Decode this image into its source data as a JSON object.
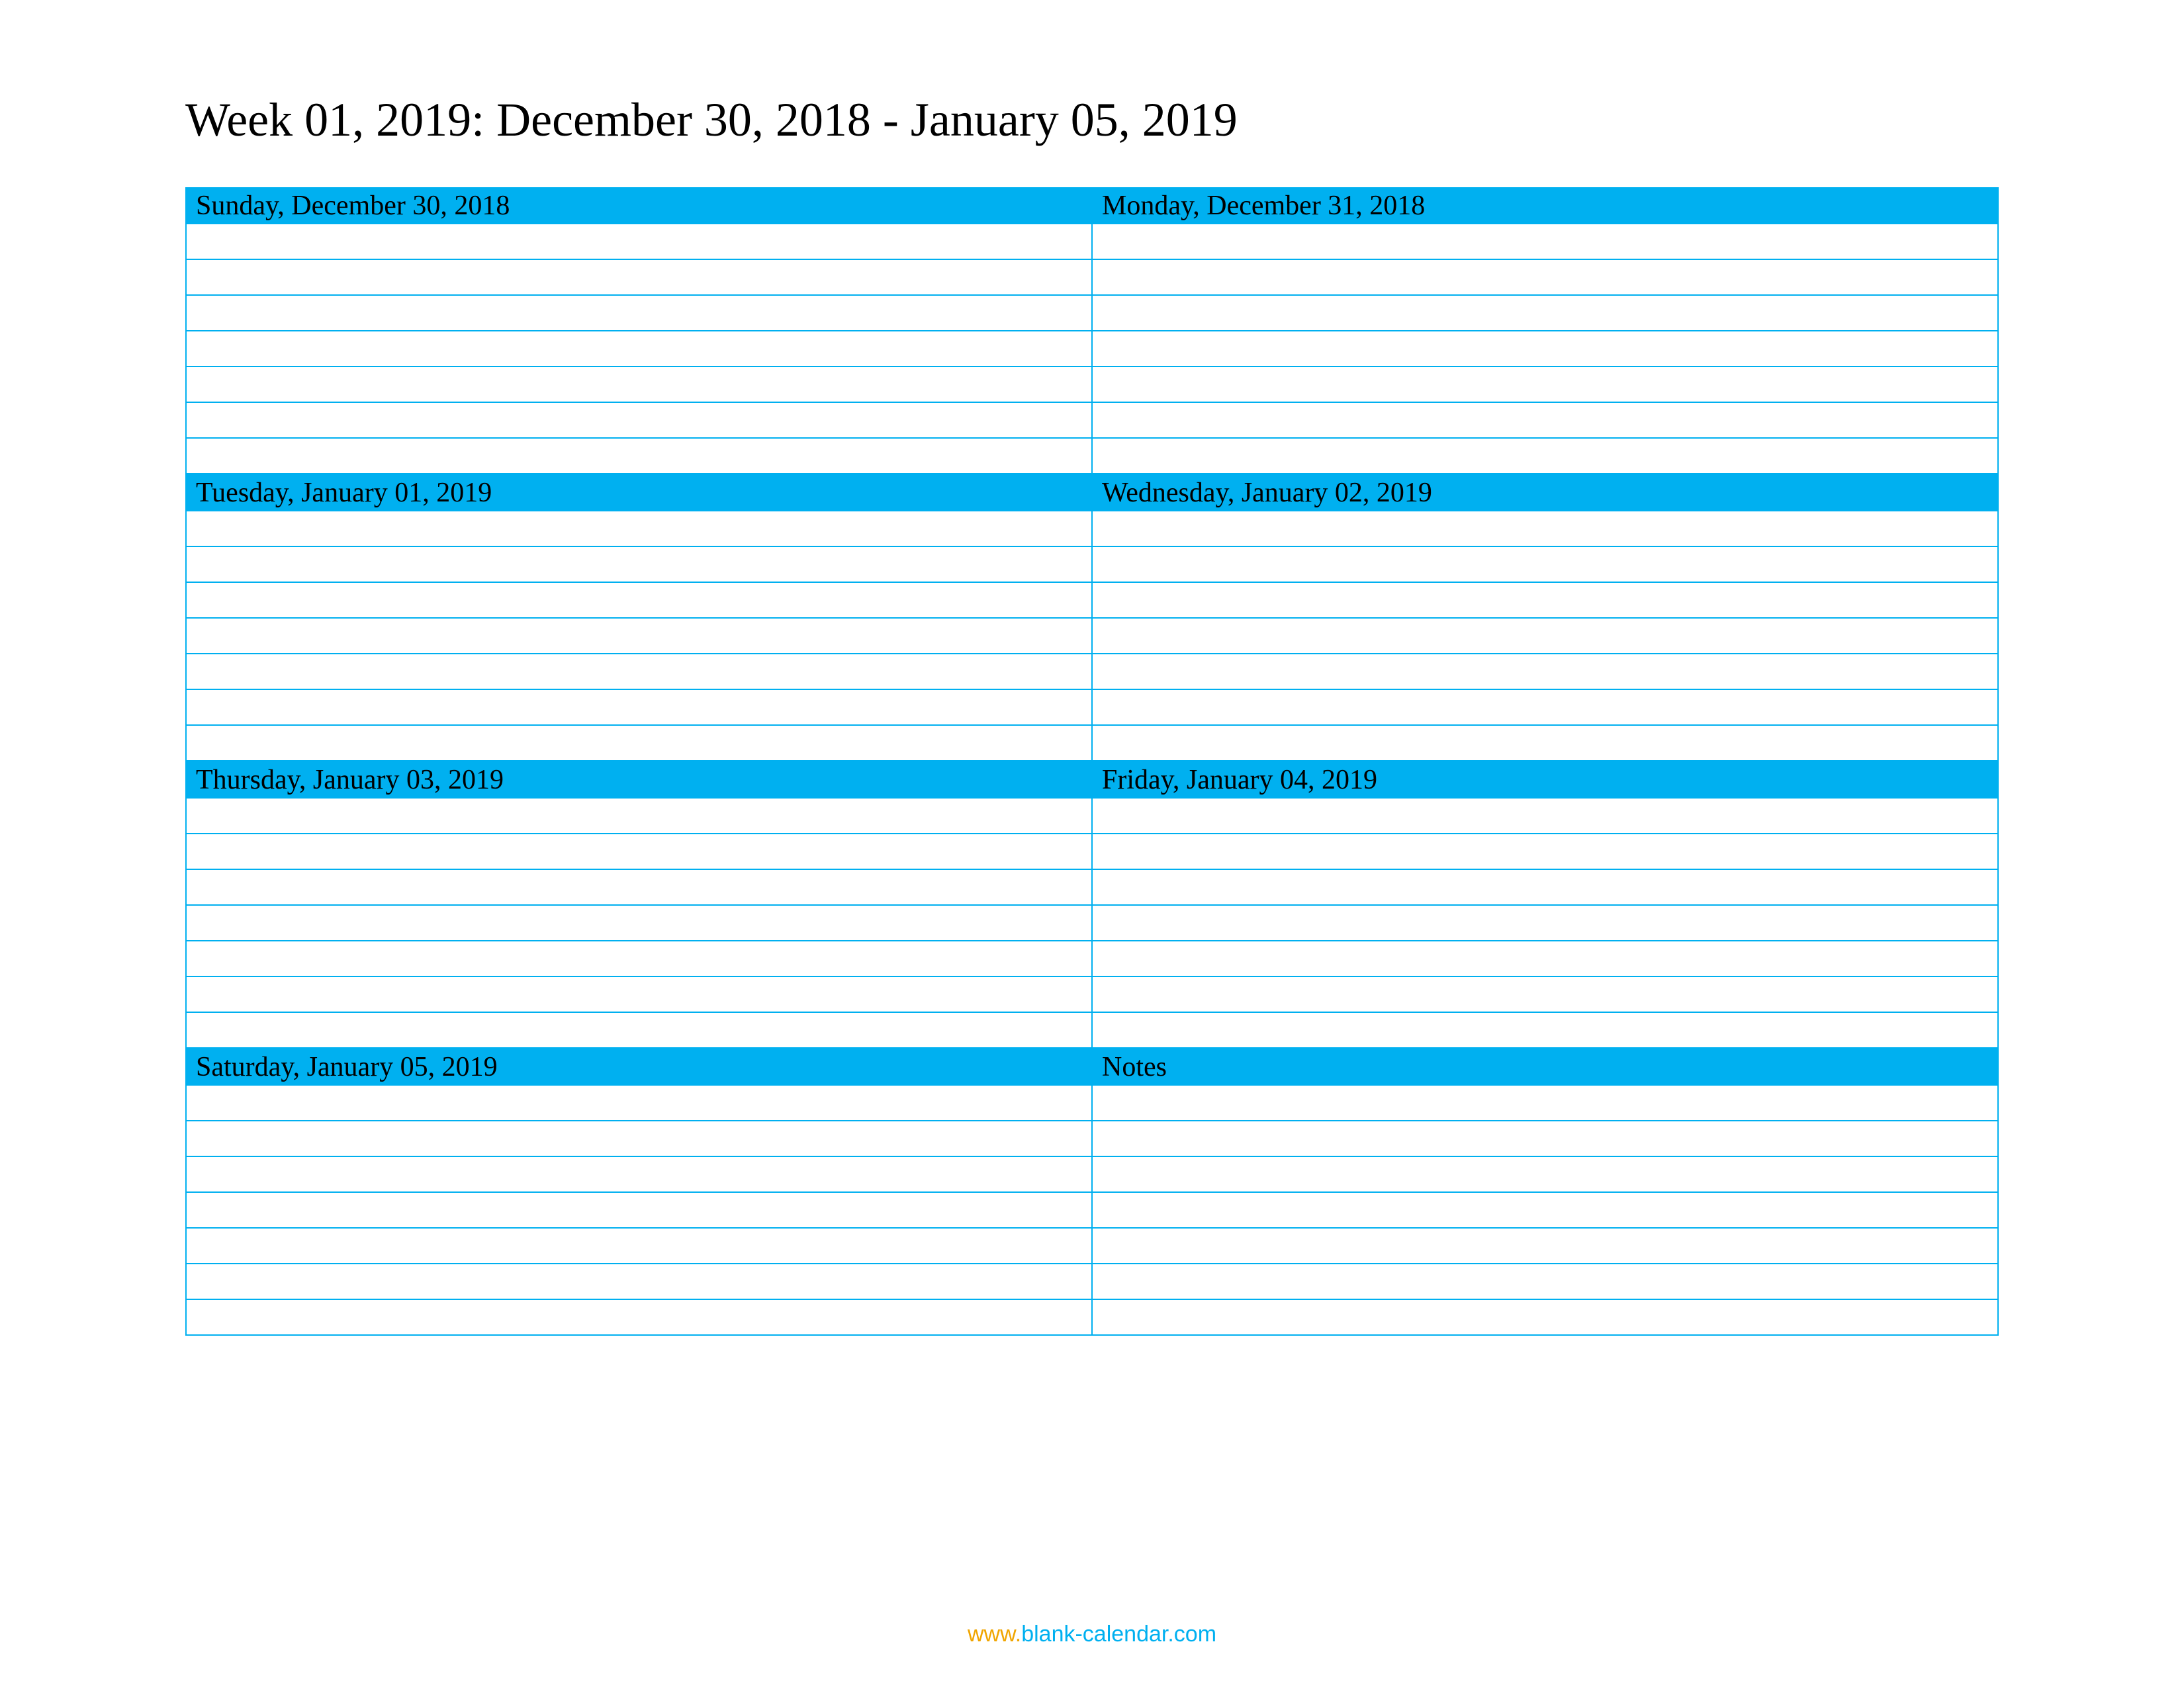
{
  "title": "Week 01, 2019: December 30, 2018 - January 05, 2019",
  "colors": {
    "header_bg": "#00b0f0",
    "border": "#00b0f0"
  },
  "rows_per_day": 7,
  "days": [
    {
      "label": "Sunday, December 30, 2018"
    },
    {
      "label": "Monday, December 31, 2018"
    },
    {
      "label": "Tuesday, January 01, 2019"
    },
    {
      "label": "Wednesday, January 02, 2019"
    },
    {
      "label": "Thursday, January 03, 2019"
    },
    {
      "label": "Friday, January 04, 2019"
    },
    {
      "label": "Saturday, January 05, 2019"
    },
    {
      "label": "Notes"
    }
  ],
  "footer": {
    "prefix": "www.",
    "domain": "blank-calendar.com"
  }
}
